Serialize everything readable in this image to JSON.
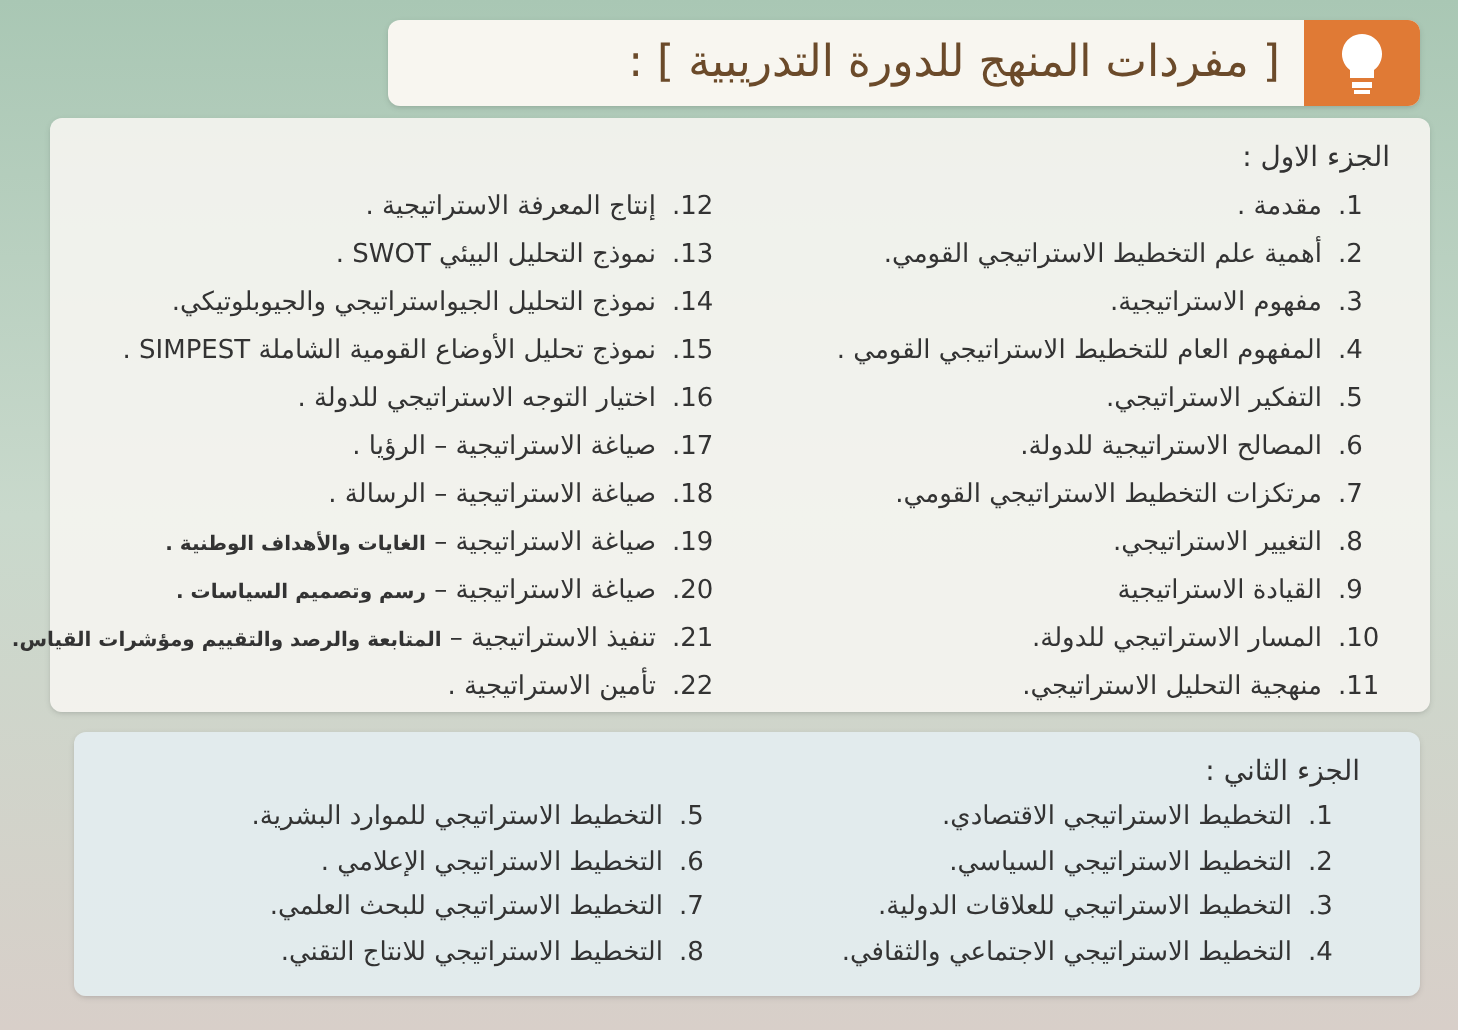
{
  "header": {
    "title": "[ مفردات المنهج للدورة التدريبية ] :"
  },
  "part_one": {
    "heading": "الجزء الاول :",
    "items": [
      {
        "number": "1.",
        "text": "مقدمة ."
      },
      {
        "number": "2.",
        "text": "أهمية علم التخطيط الاستراتيجي القومي."
      },
      {
        "number": "3.",
        "text": "مفهوم الاستراتيجية."
      },
      {
        "number": "4.",
        "text": "المفهوم العام للتخطيط الاستراتيجي القومي ."
      },
      {
        "number": "5.",
        "text": "التفكير الاستراتيجي."
      },
      {
        "number": "6.",
        "text": "المصالح الاستراتيجية للدولة."
      },
      {
        "number": "7.",
        "text": "مرتكزات التخطيط الاستراتيجي القومي."
      },
      {
        "number": "8.",
        "text": "التغيير الاستراتيجي."
      },
      {
        "number": "9.",
        "text": "القيادة الاستراتيجية"
      },
      {
        "number": "10.",
        "text": "المسار الاستراتيجي للدولة."
      },
      {
        "number": "11.",
        "text": "منهجية التحليل الاستراتيجي."
      },
      {
        "number": "12.",
        "text": "إنتاج المعرفة الاستراتيجية ."
      },
      {
        "number": "13.",
        "text": "نموذج التحليل البيئي SWOT ."
      },
      {
        "number": "14.",
        "text": "نموذج التحليل الجيواستراتيجي والجيوبلوتيكي."
      },
      {
        "number": "15.",
        "text": "نموذج تحليل الأوضاع القومية الشاملة SIMPEST ."
      },
      {
        "number": "16.",
        "text": "اختيار التوجه الاستراتيجي للدولة ."
      },
      {
        "number": "17.",
        "text": "صياغة الاستراتيجية – الرؤيا ."
      },
      {
        "number": "18.",
        "text": "صياغة الاستراتيجية – الرسالة ."
      },
      {
        "number": "19.",
        "text": "صياغة الاستراتيجية – **الغايات والأهداف الوطنية .**"
      },
      {
        "number": "20.",
        "text": "صياغة الاستراتيجية – **رسم وتصميم السياسات .**"
      },
      {
        "number": "21.",
        "text": "تنفيذ الاستراتيجية – **المتابعة والرصد والتقييم ومؤشرات القياس.**"
      },
      {
        "number": "22.",
        "text": "تأمين الاستراتيجية ."
      }
    ]
  },
  "part_two": {
    "heading": "الجزء الثاني :",
    "items": [
      {
        "number": "1.",
        "text": "التخطيط الاستراتيجي الاقتصادي."
      },
      {
        "number": "2.",
        "text": "التخطيط الاستراتيجي السياسي."
      },
      {
        "number": "3.",
        "text": "التخطيط الاستراتيجي للعلاقات الدولية."
      },
      {
        "number": "4.",
        "text": "التخطيط الاستراتيجي الاجتماعي والثقافي."
      },
      {
        "number": "5.",
        "text": "التخطيط الاستراتيجي للموارد البشرية."
      },
      {
        "number": "6.",
        "text": "التخطيط الاستراتيجي الإعلامي ."
      },
      {
        "number": "7.",
        "text": "التخطيط الاستراتيجي للبحث العلمي."
      },
      {
        "number": "8.",
        "text": "التخطيط الاستراتيجي للانتاج التقني."
      }
    ]
  }
}
